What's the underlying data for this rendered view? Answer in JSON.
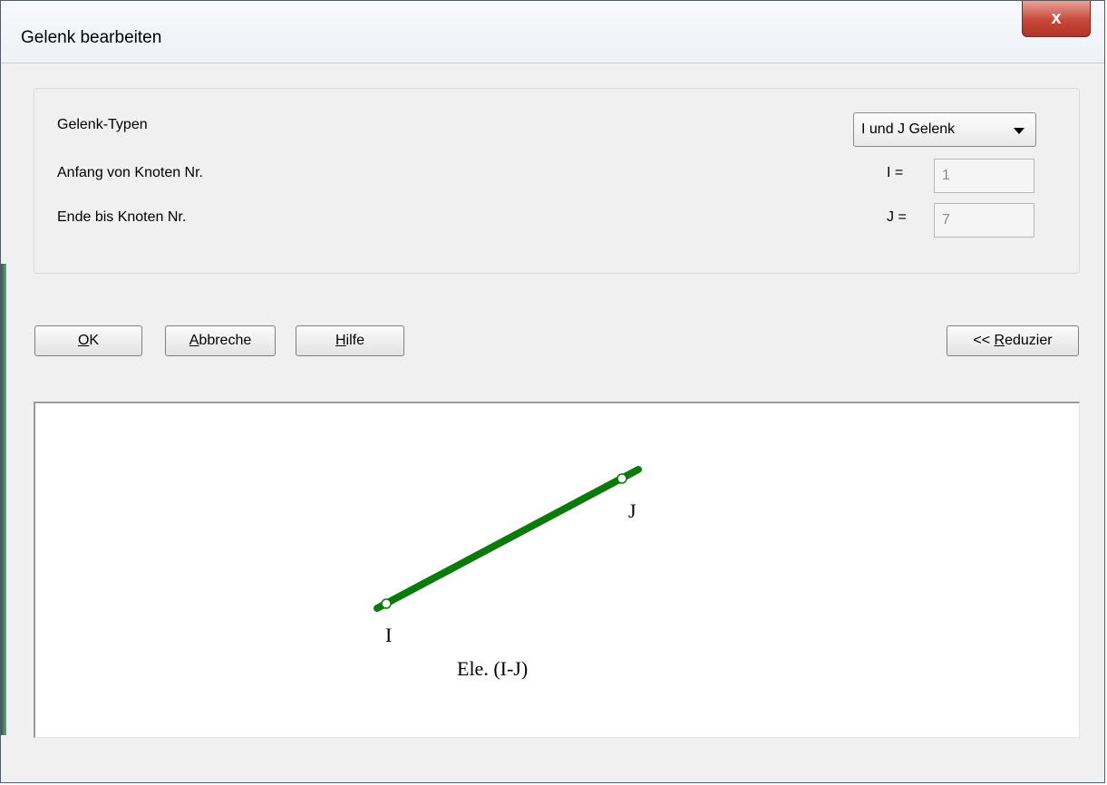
{
  "window": {
    "title": "Gelenk bearbeiten",
    "close_label": "x"
  },
  "form": {
    "type_label": "Gelenk-Typen",
    "type_selected": "I und J Gelenk",
    "start_label": "Anfang von Knoten Nr.",
    "end_label": "Ende bis Knoten Nr.",
    "i_eq": "I =",
    "j_eq": "J =",
    "i_value": "1",
    "j_value": "7"
  },
  "buttons": {
    "ok_mnemonic": "O",
    "ok_rest": "K",
    "cancel_mnemonic": "A",
    "cancel_rest": "bbreche",
    "help_mnemonic": "H",
    "help_rest": "ilfe",
    "reduce_prefix": "<< ",
    "reduce_mnemonic": "R",
    "reduce_rest": "eduzier"
  },
  "diagram": {
    "node_i_label": "I",
    "node_j_label": "J",
    "element_label": "Ele. (I-J)",
    "line_color": "#0a7a0a"
  }
}
